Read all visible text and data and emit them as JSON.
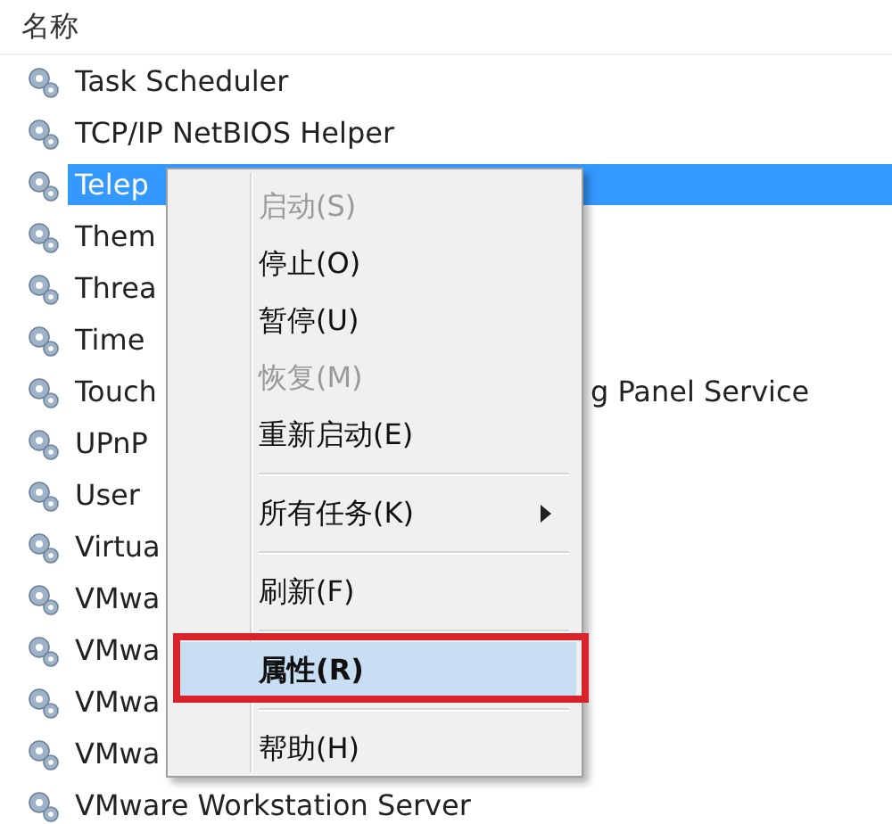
{
  "header": {
    "label": "名称"
  },
  "services": [
    {
      "name": "Task Scheduler",
      "selected": false
    },
    {
      "name": "TCP/IP NetBIOS Helper",
      "selected": false
    },
    {
      "name": "Telep",
      "selected": true
    },
    {
      "name": "Them",
      "selected": false
    },
    {
      "name": "Threa",
      "selected": false
    },
    {
      "name": "Time",
      "selected": false
    },
    {
      "name": "Touch",
      "selected": false,
      "tail": "g Panel Service"
    },
    {
      "name": "UPnP",
      "selected": false
    },
    {
      "name": "User",
      "selected": false
    },
    {
      "name": "Virtua",
      "selected": false
    },
    {
      "name": "VMwa",
      "selected": false
    },
    {
      "name": "VMwa",
      "selected": false
    },
    {
      "name": "VMwa",
      "selected": false
    },
    {
      "name": "VMwa",
      "selected": false
    },
    {
      "name": "VMware Workstation Server",
      "selected": false
    }
  ],
  "context_menu": {
    "items": [
      {
        "kind": "item",
        "label": "启动(S)",
        "disabled": true,
        "default": false,
        "submenu": false,
        "highlighted": false
      },
      {
        "kind": "item",
        "label": "停止(O)",
        "disabled": false,
        "default": false,
        "submenu": false,
        "highlighted": false
      },
      {
        "kind": "item",
        "label": "暂停(U)",
        "disabled": false,
        "default": false,
        "submenu": false,
        "highlighted": false
      },
      {
        "kind": "item",
        "label": "恢复(M)",
        "disabled": true,
        "default": false,
        "submenu": false,
        "highlighted": false
      },
      {
        "kind": "item",
        "label": "重新启动(E)",
        "disabled": false,
        "default": false,
        "submenu": false,
        "highlighted": false
      },
      {
        "kind": "separator"
      },
      {
        "kind": "item",
        "label": "所有任务(K)",
        "disabled": false,
        "default": false,
        "submenu": true,
        "highlighted": false
      },
      {
        "kind": "separator"
      },
      {
        "kind": "item",
        "label": "刷新(F)",
        "disabled": false,
        "default": false,
        "submenu": false,
        "highlighted": false
      },
      {
        "kind": "separator"
      },
      {
        "kind": "item",
        "label": "属性(R)",
        "disabled": false,
        "default": true,
        "submenu": false,
        "highlighted": true
      },
      {
        "kind": "separator"
      },
      {
        "kind": "item",
        "label": "帮助(H)",
        "disabled": false,
        "default": false,
        "submenu": false,
        "highlighted": false
      }
    ]
  }
}
